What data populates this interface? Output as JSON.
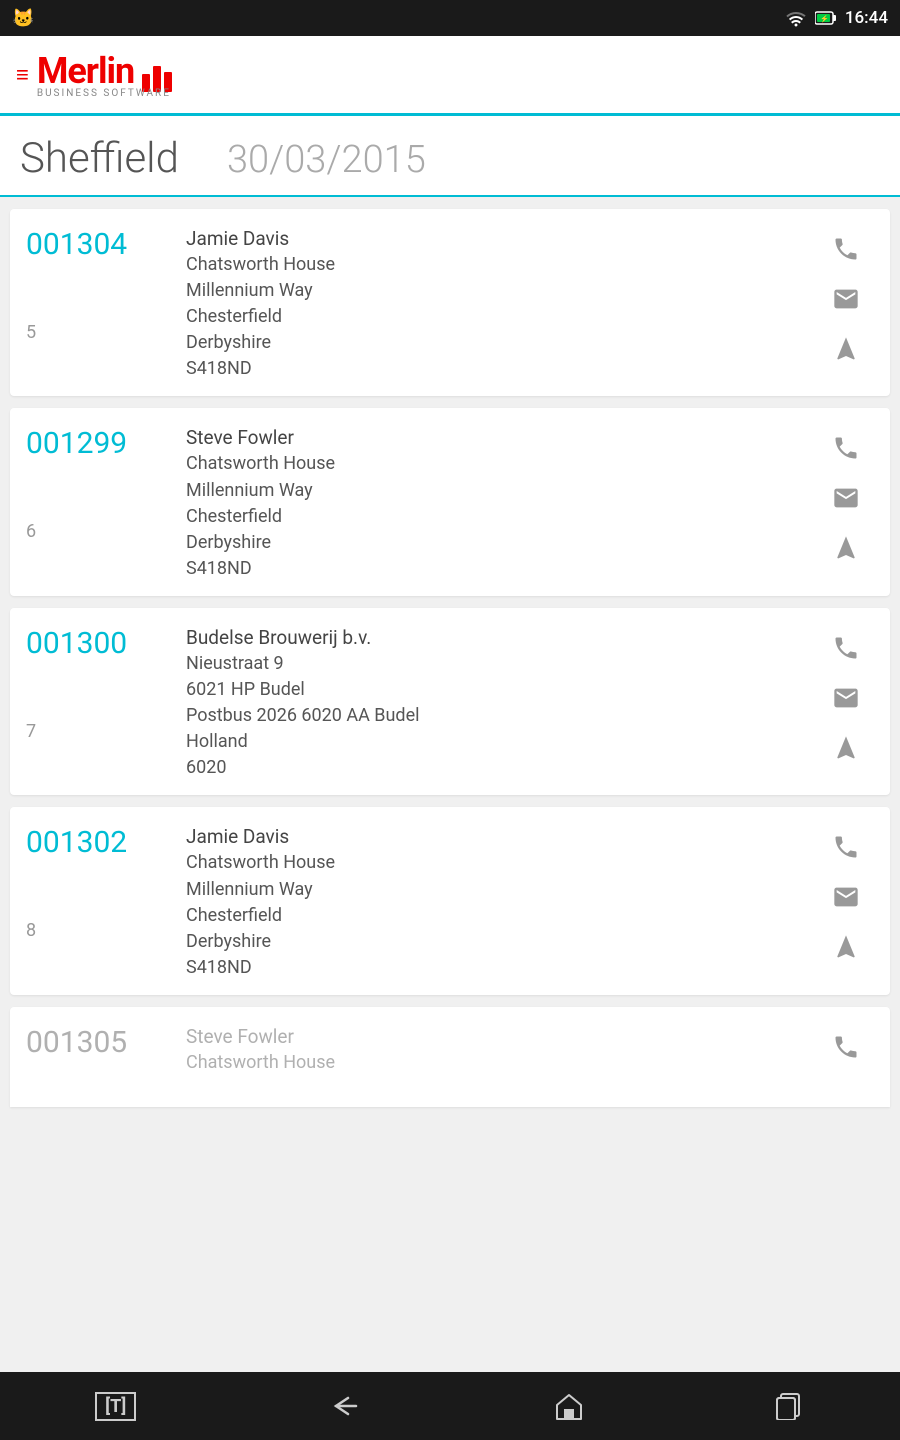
{
  "statusBar": {
    "time": "16:44",
    "wifiLabel": "wifi",
    "batteryLabel": "battery"
  },
  "header": {
    "logoText": "Merlin",
    "logoSubtitle": "BUSINESS SOFTWARE"
  },
  "pageTitle": {
    "city": "Sheffield",
    "date": "30/03/2015"
  },
  "cards": [
    {
      "id": "001304",
      "number": "5",
      "name": "Jamie Davis",
      "address": [
        "Chatsworth House",
        "Millennium Way",
        "Chesterfield",
        "Derbyshire",
        "S418ND"
      ],
      "dimmed": false
    },
    {
      "id": "001299",
      "number": "6",
      "name": "Steve Fowler",
      "address": [
        "Chatsworth House",
        "Millennium Way",
        "Chesterfield",
        "Derbyshire",
        "S418ND"
      ],
      "dimmed": false
    },
    {
      "id": "001300",
      "number": "7",
      "name": "Budelse Brouwerij b.v.",
      "address": [
        "Nieustraat 9",
        "6021 HP Budel",
        "Postbus 2026   6020 AA Budel",
        "Holland",
        "6020"
      ],
      "dimmed": false
    },
    {
      "id": "001302",
      "number": "8",
      "name": "Jamie Davis",
      "address": [
        "Chatsworth House",
        "Millennium Way",
        "Chesterfield",
        "Derbyshire",
        "S418ND"
      ],
      "dimmed": false
    },
    {
      "id": "001305",
      "number": "",
      "name": "Steve Fowler",
      "address": [
        "Chatsworth House"
      ],
      "dimmed": true,
      "partial": true
    }
  ],
  "bottomNav": {
    "tLabel": "[T]",
    "backLabel": "back",
    "homeLabel": "home",
    "recentLabel": "recent"
  }
}
